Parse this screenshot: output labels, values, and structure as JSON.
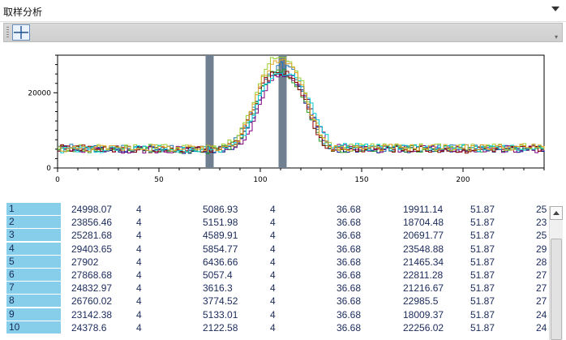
{
  "window": {
    "title": "取样分析"
  },
  "toolbar": {
    "tool_icon": "crosshair-icon"
  },
  "chart_data": {
    "type": "line",
    "xlim": [
      0,
      240
    ],
    "ylim": [
      0,
      30000
    ],
    "x_ticks": [
      0,
      50,
      100,
      150,
      200
    ],
    "y_ticks": [
      0,
      20000
    ],
    "grid": false,
    "legend": "none",
    "markers": [
      {
        "x": 75,
        "color": "#708090"
      },
      {
        "x": 111,
        "color": "#708090"
      }
    ],
    "series": [
      {
        "color": "#000080",
        "values": [
          [
            0,
            5200
          ],
          [
            40,
            4900
          ],
          [
            70,
            4700
          ],
          [
            80,
            4800
          ],
          [
            88,
            6000
          ],
          [
            95,
            12000
          ],
          [
            100,
            20000
          ],
          [
            105,
            24000
          ],
          [
            110,
            25000
          ],
          [
            115,
            24500
          ],
          [
            120,
            20000
          ],
          [
            125,
            13000
          ],
          [
            130,
            7000
          ],
          [
            135,
            5000
          ],
          [
            160,
            4900
          ],
          [
            200,
            5100
          ],
          [
            240,
            5000
          ]
        ]
      },
      {
        "color": "#1f77b4",
        "values": [
          [
            0,
            5600
          ],
          [
            40,
            5300
          ],
          [
            70,
            5000
          ],
          [
            80,
            5100
          ],
          [
            88,
            7500
          ],
          [
            95,
            15000
          ],
          [
            100,
            22000
          ],
          [
            105,
            26000
          ],
          [
            110,
            27500
          ],
          [
            115,
            26000
          ],
          [
            120,
            21000
          ],
          [
            125,
            14000
          ],
          [
            130,
            7500
          ],
          [
            135,
            5200
          ],
          [
            160,
            5300
          ],
          [
            200,
            5400
          ],
          [
            240,
            5500
          ]
        ]
      },
      {
        "color": "#2ca02c",
        "values": [
          [
            0,
            4900
          ],
          [
            40,
            5100
          ],
          [
            70,
            4600
          ],
          [
            80,
            4900
          ],
          [
            88,
            6500
          ],
          [
            95,
            13000
          ],
          [
            100,
            21000
          ],
          [
            105,
            25500
          ],
          [
            110,
            26000
          ],
          [
            115,
            24000
          ],
          [
            120,
            19000
          ],
          [
            125,
            12500
          ],
          [
            130,
            6500
          ],
          [
            135,
            4900
          ],
          [
            160,
            5200
          ],
          [
            200,
            5000
          ],
          [
            240,
            5300
          ]
        ]
      },
      {
        "color": "#9acd32",
        "values": [
          [
            0,
            5400
          ],
          [
            40,
            5500
          ],
          [
            70,
            5200
          ],
          [
            80,
            5300
          ],
          [
            88,
            8000
          ],
          [
            95,
            16000
          ],
          [
            100,
            24000
          ],
          [
            105,
            28500
          ],
          [
            110,
            29500
          ],
          [
            115,
            28000
          ],
          [
            120,
            23000
          ],
          [
            125,
            15000
          ],
          [
            130,
            8000
          ],
          [
            135,
            5400
          ],
          [
            160,
            5600
          ],
          [
            200,
            5500
          ],
          [
            240,
            5700
          ]
        ]
      },
      {
        "color": "#800080",
        "values": [
          [
            0,
            5000
          ],
          [
            40,
            4800
          ],
          [
            70,
            5000
          ],
          [
            80,
            4700
          ],
          [
            88,
            5500
          ],
          [
            95,
            11000
          ],
          [
            100,
            19000
          ],
          [
            105,
            23500
          ],
          [
            110,
            24500
          ],
          [
            115,
            24000
          ],
          [
            120,
            21000
          ],
          [
            125,
            15000
          ],
          [
            130,
            9000
          ],
          [
            135,
            5500
          ],
          [
            160,
            5000
          ],
          [
            200,
            5200
          ],
          [
            240,
            4900
          ]
        ]
      },
      {
        "color": "#8b0000",
        "values": [
          [
            0,
            5300
          ],
          [
            40,
            5000
          ],
          [
            70,
            4800
          ],
          [
            80,
            5000
          ],
          [
            88,
            7000
          ],
          [
            95,
            14000
          ],
          [
            100,
            22000
          ],
          [
            105,
            25000
          ],
          [
            110,
            25500
          ],
          [
            115,
            24500
          ],
          [
            120,
            20000
          ],
          [
            125,
            12000
          ],
          [
            130,
            6500
          ],
          [
            135,
            5100
          ],
          [
            160,
            5100
          ],
          [
            200,
            4800
          ],
          [
            240,
            5200
          ]
        ]
      },
      {
        "color": "#00ced1",
        "values": [
          [
            0,
            4800
          ],
          [
            40,
            5200
          ],
          [
            70,
            4900
          ],
          [
            80,
            5000
          ],
          [
            88,
            6200
          ],
          [
            95,
            12500
          ],
          [
            100,
            20500
          ],
          [
            105,
            24500
          ],
          [
            110,
            25500
          ],
          [
            115,
            25000
          ],
          [
            120,
            22000
          ],
          [
            125,
            16000
          ],
          [
            130,
            9500
          ],
          [
            135,
            6000
          ],
          [
            160,
            5400
          ],
          [
            200,
            5300
          ],
          [
            240,
            5100
          ]
        ]
      },
      {
        "color": "#daa520",
        "values": [
          [
            0,
            5100
          ],
          [
            40,
            5400
          ],
          [
            70,
            5100
          ],
          [
            80,
            5200
          ],
          [
            88,
            7200
          ],
          [
            95,
            15500
          ],
          [
            100,
            23500
          ],
          [
            105,
            27500
          ],
          [
            110,
            28500
          ],
          [
            115,
            27000
          ],
          [
            120,
            22000
          ],
          [
            125,
            14000
          ],
          [
            130,
            7500
          ],
          [
            135,
            5300
          ],
          [
            160,
            5500
          ],
          [
            200,
            5400
          ],
          [
            240,
            5600
          ]
        ]
      }
    ]
  },
  "table": {
    "rows": [
      [
        "1",
        "24998.07",
        "4",
        "5086.93",
        "4",
        "36.68",
        "19911.14",
        "51.87",
        "25"
      ],
      [
        "2",
        "23856.46",
        "4",
        "5151.98",
        "4",
        "36.68",
        "18704.48",
        "51.87",
        "23"
      ],
      [
        "3",
        "25281.68",
        "4",
        "4589.91",
        "4",
        "36.68",
        "20691.77",
        "51.87",
        "25"
      ],
      [
        "4",
        "29403.65",
        "4",
        "5854.77",
        "4",
        "36.68",
        "23548.88",
        "51.87",
        "29"
      ],
      [
        "5",
        "27902",
        "4",
        "6436.66",
        "4",
        "36.68",
        "21465.34",
        "51.87",
        "28"
      ],
      [
        "6",
        "27868.68",
        "4",
        "5057.4",
        "4",
        "36.68",
        "22811.28",
        "51.87",
        "27"
      ],
      [
        "7",
        "24832.97",
        "4",
        "3616.3",
        "4",
        "36.68",
        "21216.67",
        "51.87",
        "27"
      ],
      [
        "8",
        "26760.02",
        "4",
        "3774.52",
        "4",
        "36.68",
        "22985.5",
        "51.87",
        "27"
      ],
      [
        "9",
        "23142.38",
        "4",
        "5133.01",
        "4",
        "36.68",
        "18009.37",
        "51.87",
        "24"
      ],
      [
        "10",
        "24378.6",
        "4",
        "2122.58",
        "4",
        "36.68",
        "22256.02",
        "51.87",
        "24"
      ]
    ]
  }
}
